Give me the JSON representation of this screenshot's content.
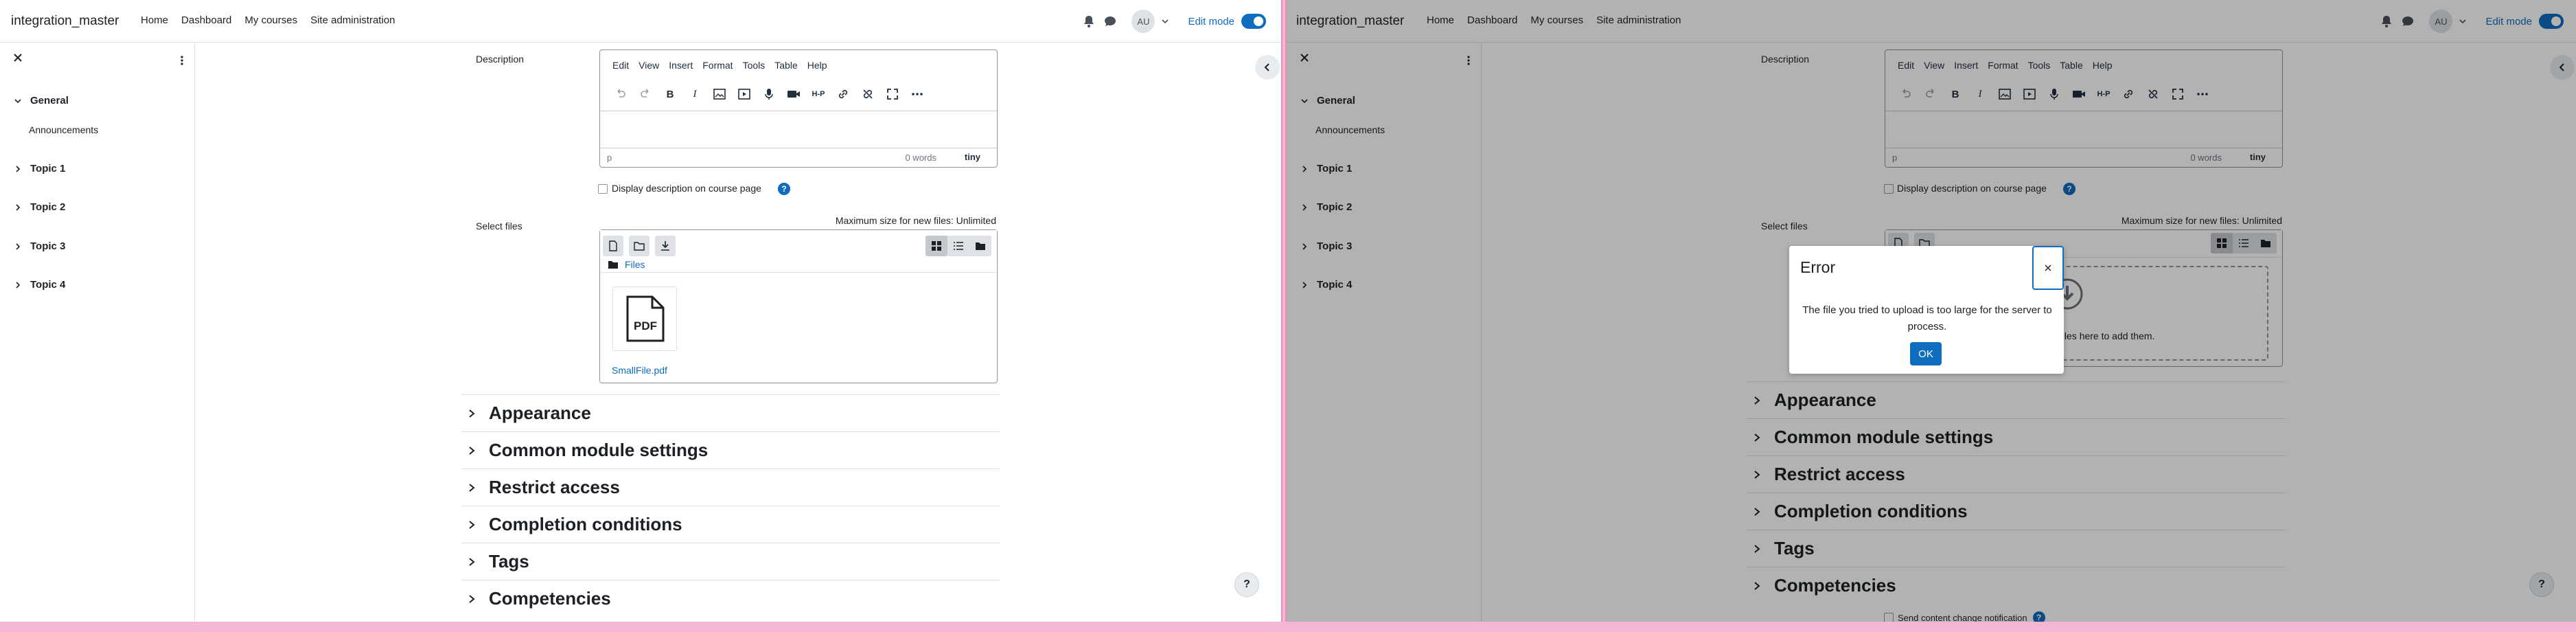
{
  "navbar": {
    "site_name": "integration_master",
    "links": [
      "Home",
      "Dashboard",
      "My courses",
      "Site administration"
    ],
    "avatar_initials": "AU",
    "edit_mode_label": "Edit mode"
  },
  "course_index": {
    "sections": [
      {
        "title": "General",
        "items": [
          "Announcements"
        ]
      },
      {
        "title": "Topic 1",
        "items": []
      },
      {
        "title": "Topic 2",
        "items": []
      },
      {
        "title": "Topic 3",
        "items": []
      },
      {
        "title": "Topic 4",
        "items": []
      }
    ]
  },
  "form": {
    "description_label": "Description",
    "editor": {
      "menus": [
        "Edit",
        "View",
        "Insert",
        "Format",
        "Tools",
        "Table",
        "Help"
      ],
      "path": "p",
      "word_count": "0 words",
      "brand": "tiny"
    },
    "show_description_label": "Display description on course page",
    "select_files_label": "Select files",
    "max_size": "Maximum size for new files: Unlimited",
    "files_path": "Files",
    "file_name": "SmallFile.pdf",
    "pdf_icon_text": "PDF",
    "dropzone_text": "drop files here to add them.",
    "sections": [
      "Appearance",
      "Common module settings",
      "Restrict access",
      "Completion conditions",
      "Tags",
      "Competencies"
    ],
    "notify_label": "Send content change notification"
  },
  "modal": {
    "title": "Error",
    "message": "The file you tried to upload is too large for the server to process.",
    "ok_label": "OK"
  },
  "colors": {
    "primary": "#0f6cbf",
    "text": "#1d2125",
    "backdrop": "rgba(0,0,0,0.3)",
    "frame": "#f4b6d2"
  }
}
